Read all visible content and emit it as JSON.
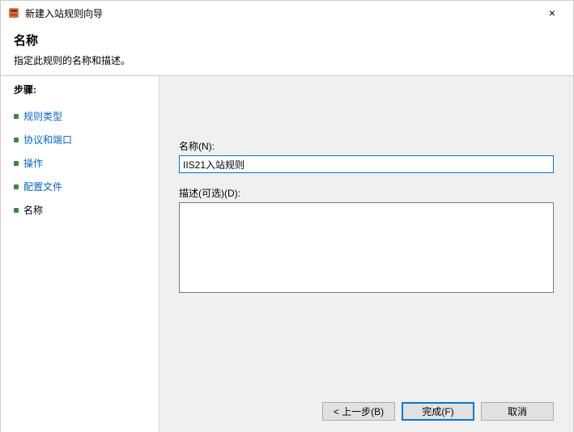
{
  "window": {
    "title": "新建入站规则向导",
    "close_label": "×"
  },
  "header": {
    "title": "名称",
    "description": "指定此规则的名称和描述。"
  },
  "sidebar": {
    "steps_heading": "步骤:",
    "items": [
      {
        "label": "规则类型",
        "current": false
      },
      {
        "label": "协议和端口",
        "current": false
      },
      {
        "label": "操作",
        "current": false
      },
      {
        "label": "配置文件",
        "current": false
      },
      {
        "label": "名称",
        "current": true
      }
    ]
  },
  "form": {
    "name_label": "名称(N):",
    "name_value": "IIS21入站规则",
    "desc_label": "描述(可选)(D):",
    "desc_value": ""
  },
  "buttons": {
    "back": "< 上一步(B)",
    "finish": "完成(F)",
    "cancel": "取消"
  }
}
